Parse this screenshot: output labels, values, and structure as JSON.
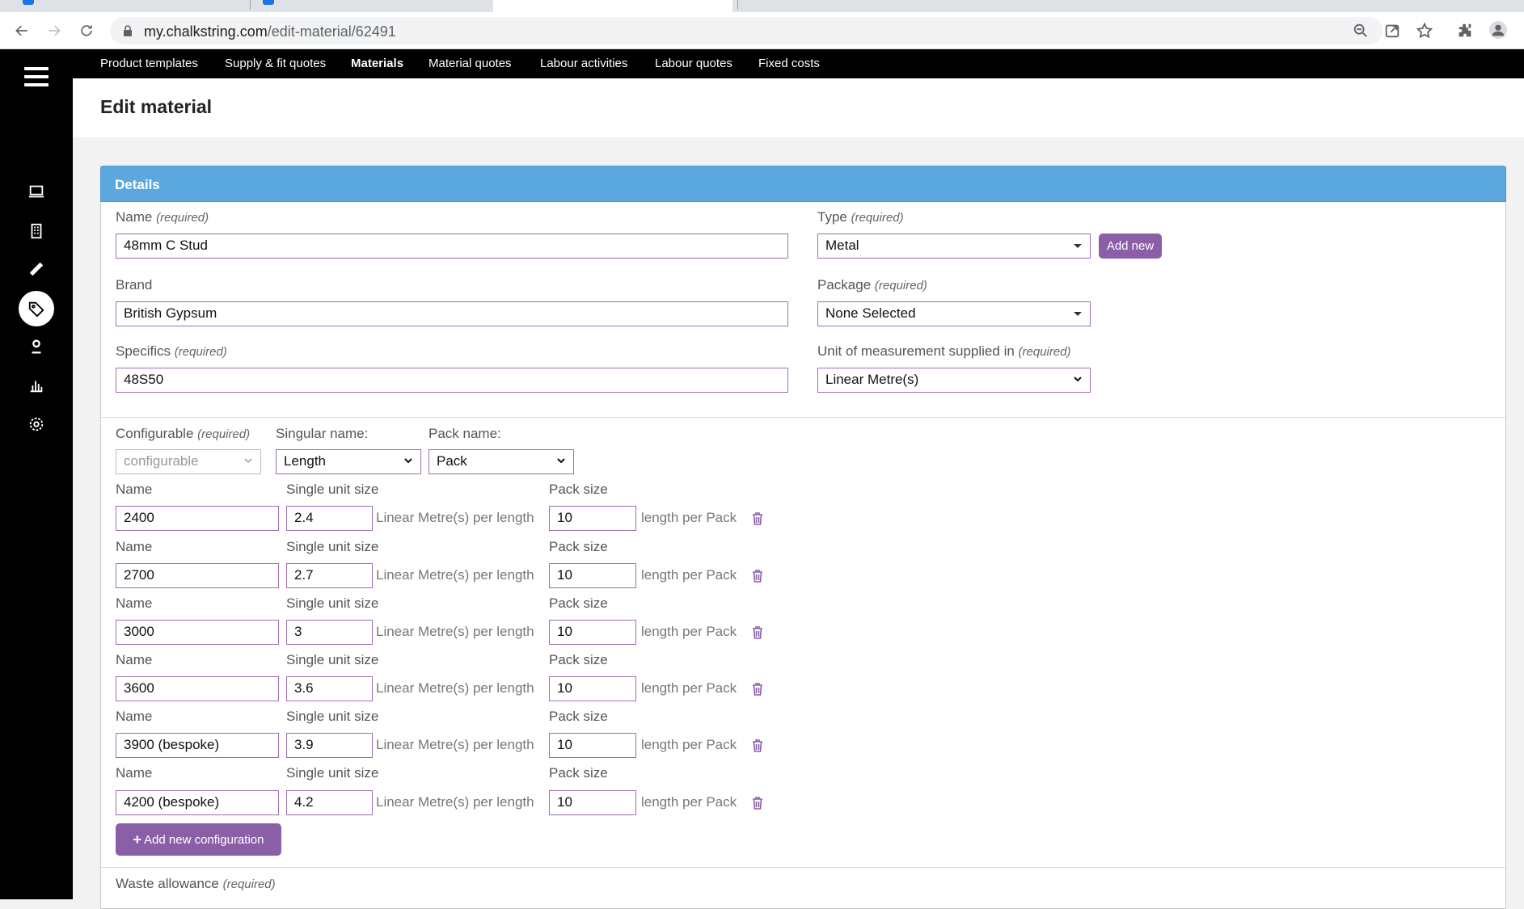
{
  "browser": {
    "url_host": "my.chalkstring.com",
    "url_path": "/edit-material/62491"
  },
  "top_nav": {
    "items": [
      {
        "label": "Product templates"
      },
      {
        "label": "Supply & fit quotes"
      },
      {
        "label": "Materials",
        "active": true
      },
      {
        "label": "Material quotes"
      },
      {
        "label": "Labour activities"
      },
      {
        "label": "Labour quotes"
      },
      {
        "label": "Fixed costs"
      }
    ]
  },
  "sidebar": {
    "icons": [
      "menu-icon",
      "laptop-icon",
      "building-icon",
      "ruler-icon",
      "tag-icon",
      "user-icon",
      "chart-icon",
      "settings-icon"
    ],
    "active": "tag-icon"
  },
  "page": {
    "title": "Edit material"
  },
  "details": {
    "heading": "Details",
    "name": {
      "label": "Name",
      "req": "(required)",
      "value": "48mm C Stud"
    },
    "brand": {
      "label": "Brand",
      "value": "British Gypsum"
    },
    "specifics": {
      "label": "Specifics",
      "req": "(required)",
      "value": "48S50"
    },
    "type": {
      "label": "Type",
      "req": "(required)",
      "value": "Metal",
      "add_new": "Add new"
    },
    "package": {
      "label": "Package",
      "req": "(required)",
      "value": "None Selected"
    },
    "unit": {
      "label": "Unit of measurement supplied in",
      "req": "(required)",
      "value": "Linear Metre(s)"
    }
  },
  "configuration": {
    "configurable_label": "Configurable",
    "configurable_req": "(required)",
    "configurable_value": "configurable",
    "singular_label": "Singular name:",
    "singular_value": "Length",
    "pack_label": "Pack name:",
    "pack_value": "Pack",
    "col_name": "Name",
    "col_unit_size": "Single unit size",
    "col_pack_size": "Pack size",
    "unit_suffix": "Linear Metre(s)  per length",
    "pack_suffix": "length per Pack",
    "rows": [
      {
        "name": "2400",
        "size": "2.4",
        "pack": "10"
      },
      {
        "name": "2700",
        "size": "2.7",
        "pack": "10"
      },
      {
        "name": "3000",
        "size": "3",
        "pack": "10"
      },
      {
        "name": "3600",
        "size": "3.6",
        "pack": "10"
      },
      {
        "name": "3900 (bespoke)",
        "size": "3.9",
        "pack": "10"
      },
      {
        "name": "4200 (bespoke)",
        "size": "4.2",
        "pack": "10"
      }
    ],
    "add_button": "Add new configuration"
  },
  "waste": {
    "label": "Waste allowance",
    "req": "(required)"
  },
  "colors": {
    "accent": "#8a5fa8",
    "panel_header": "#5ba8df",
    "sidebar": "#000000"
  }
}
